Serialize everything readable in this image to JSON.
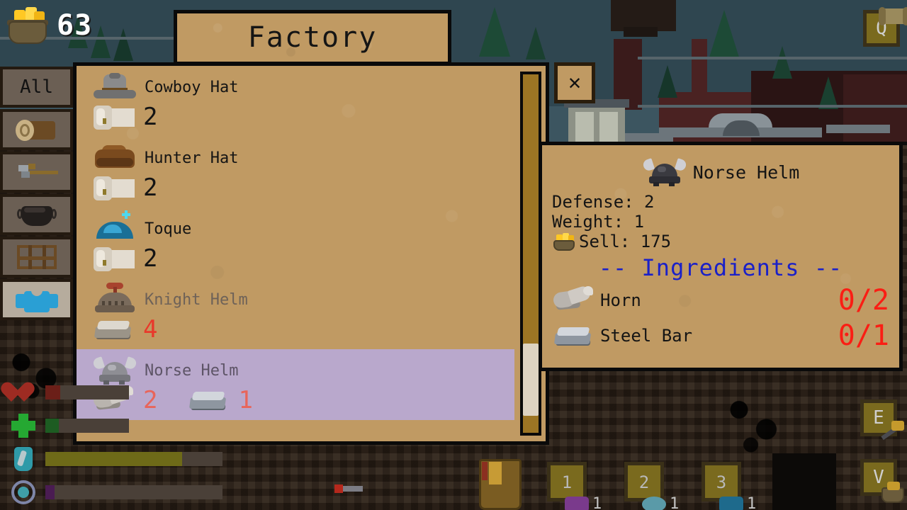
{
  "hud": {
    "gold_amount": "63",
    "gold_icon": "coin-pouch-icon",
    "status_bars": [
      {
        "name": "health",
        "icon": "heart-icon",
        "fill_pct": 18,
        "color": "#6b1f18"
      },
      {
        "name": "stamina",
        "icon": "green-cross-icon",
        "fill_pct": 16,
        "color": "#1d5c22"
      },
      {
        "name": "mana",
        "icon": "gem-icon",
        "fill_pct": 77,
        "color": "#6e6a18"
      },
      {
        "name": "exp",
        "icon": "ring-icon",
        "fill_pct": 5,
        "color": "#4a1c52"
      }
    ],
    "keys": [
      {
        "id": "q",
        "label": "Q",
        "icon": "scroll-icon"
      },
      {
        "id": "e",
        "label": "E",
        "icon": "pickaxe-icon"
      },
      {
        "id": "v",
        "label": "V",
        "icon": "bag-icon"
      }
    ],
    "hotbar": [
      {
        "slot": "1",
        "count": "1",
        "icon": "purple-ore-icon",
        "color": "#7a3a8c"
      },
      {
        "slot": "2",
        "count": "1",
        "icon": "blue-gem-icon",
        "color": "#5a9aa8"
      },
      {
        "slot": "3",
        "count": "1",
        "icon": "teal-ore-icon",
        "color": "#1e6a8c"
      }
    ]
  },
  "window": {
    "title": "Factory",
    "close_label": "✕"
  },
  "categories": [
    {
      "id": "all",
      "label": "All",
      "icon": "all-label",
      "selected": false
    },
    {
      "id": "wood",
      "label": "",
      "icon": "log-icon",
      "selected": false
    },
    {
      "id": "tools",
      "label": "",
      "icon": "tool-icon",
      "selected": false
    },
    {
      "id": "cooking",
      "label": "",
      "icon": "pot-icon",
      "selected": false
    },
    {
      "id": "furniture",
      "label": "",
      "icon": "shelf-icon",
      "selected": false
    },
    {
      "id": "clothing",
      "label": "",
      "icon": "shirt-icon",
      "selected": true
    }
  ],
  "recipes": [
    {
      "name": "Cowboy Hat",
      "icon": "cowboy-hat-icon",
      "locked": false,
      "selected": false,
      "ingredients": [
        {
          "icon": "cloth-icon",
          "qty": "2",
          "lacking": false
        }
      ]
    },
    {
      "name": "Hunter Hat",
      "icon": "hunter-hat-icon",
      "locked": false,
      "selected": false,
      "ingredients": [
        {
          "icon": "cloth-icon",
          "qty": "2",
          "lacking": false
        }
      ]
    },
    {
      "name": "Toque",
      "icon": "toque-icon",
      "locked": false,
      "selected": false,
      "ingredients": [
        {
          "icon": "cloth-icon",
          "qty": "2",
          "lacking": false
        }
      ]
    },
    {
      "name": "Knight Helm",
      "icon": "knight-helm-icon",
      "locked": true,
      "selected": false,
      "ingredients": [
        {
          "icon": "stone-bar-icon",
          "qty": "4",
          "lacking": true
        }
      ]
    },
    {
      "name": "Norse Helm",
      "icon": "norse-helm-icon",
      "locked": false,
      "selected": true,
      "ingredients": [
        {
          "icon": "horn-icon",
          "qty": "2",
          "lacking": true
        },
        {
          "icon": "steel-bar-icon",
          "qty": "1",
          "lacking": true
        }
      ]
    }
  ],
  "info": {
    "title": "Norse Helm",
    "icon": "norse-helm-icon",
    "stats": [
      {
        "label": "Defense: 2",
        "icon": null
      },
      {
        "label": "Weight: 1",
        "icon": null
      },
      {
        "label": "Sell: 175",
        "icon": "coin-pouch-icon"
      }
    ],
    "ingredients_header": "-- Ingredients --",
    "ingredients_header_color": "#1a20c8",
    "ingredients": [
      {
        "name": "Horn",
        "icon": "horn-icon",
        "count": "0/2",
        "color": "#fa1e14"
      },
      {
        "name": "Steel Bar",
        "icon": "steel-bar-icon",
        "count": "0/1",
        "color": "#fa1e14"
      }
    ]
  },
  "scrollbar": {
    "name": "recipe-list-scrollbar"
  }
}
